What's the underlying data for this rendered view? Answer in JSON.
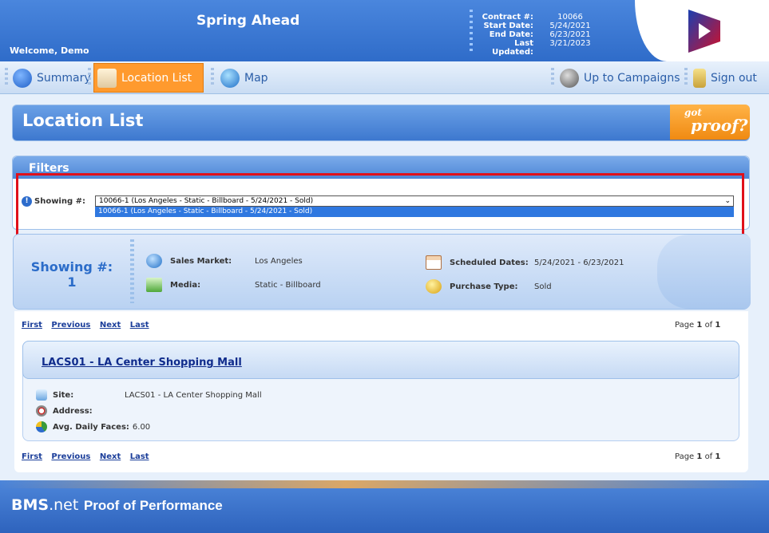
{
  "header": {
    "campaign_title": "Spring Ahead",
    "welcome": "Welcome, Demo",
    "contract": [
      {
        "label": "Contract #:",
        "value": "10066"
      },
      {
        "label": "Start Date:",
        "value": "5/24/2021"
      },
      {
        "label": "End Date:",
        "value": "6/23/2021"
      },
      {
        "label": "Last Updated:",
        "value": "3/21/2023"
      }
    ]
  },
  "nav": {
    "summary": "Summary",
    "location_list": "Location List",
    "map": "Map",
    "up_to_campaigns": "Up to Campaigns",
    "sign_out": "Sign out"
  },
  "page_title": "Location List",
  "badge": {
    "line1": "got",
    "line2": "proof?"
  },
  "filters": {
    "title": "Filters",
    "showing_label": "Showing #:",
    "selected_value": "10066-1 (Los Angeles - Static - Billboard - 5/24/2021 - Sold)",
    "options": [
      "10066-1 (Los Angeles - Static - Billboard - 5/24/2021 - Sold)"
    ]
  },
  "showing": {
    "heading": "Showing #:",
    "number": "1",
    "sales_market_label": "Sales Market:",
    "sales_market": "Los Angeles",
    "media_label": "Media:",
    "media": "Static - Billboard",
    "scheduled_label": "Scheduled Dates:",
    "scheduled": "5/24/2021 - 6/23/2021",
    "purchase_label": "Purchase Type:",
    "purchase": "Sold"
  },
  "pager": {
    "first": "First",
    "previous": "Previous",
    "next": "Next",
    "last": "Last",
    "page_word": "Page",
    "page_num": "1",
    "of_word": "of",
    "page_total": "1"
  },
  "location": {
    "title": "LACS01 - LA Center Shopping Mall",
    "site_label": "Site:",
    "site": "LACS01 - LA Center Shopping Mall",
    "address_label": "Address:",
    "address": "",
    "faces_label": "Avg. Daily Faces:",
    "faces": "6.00"
  },
  "footer": {
    "bms": "BMS",
    "net": ".net",
    "pop": "Proof of Performance"
  },
  "colors": {
    "accent": "#ff9a2e",
    "primary": "#2f6cc9",
    "highlight_box": "#e0101a"
  }
}
